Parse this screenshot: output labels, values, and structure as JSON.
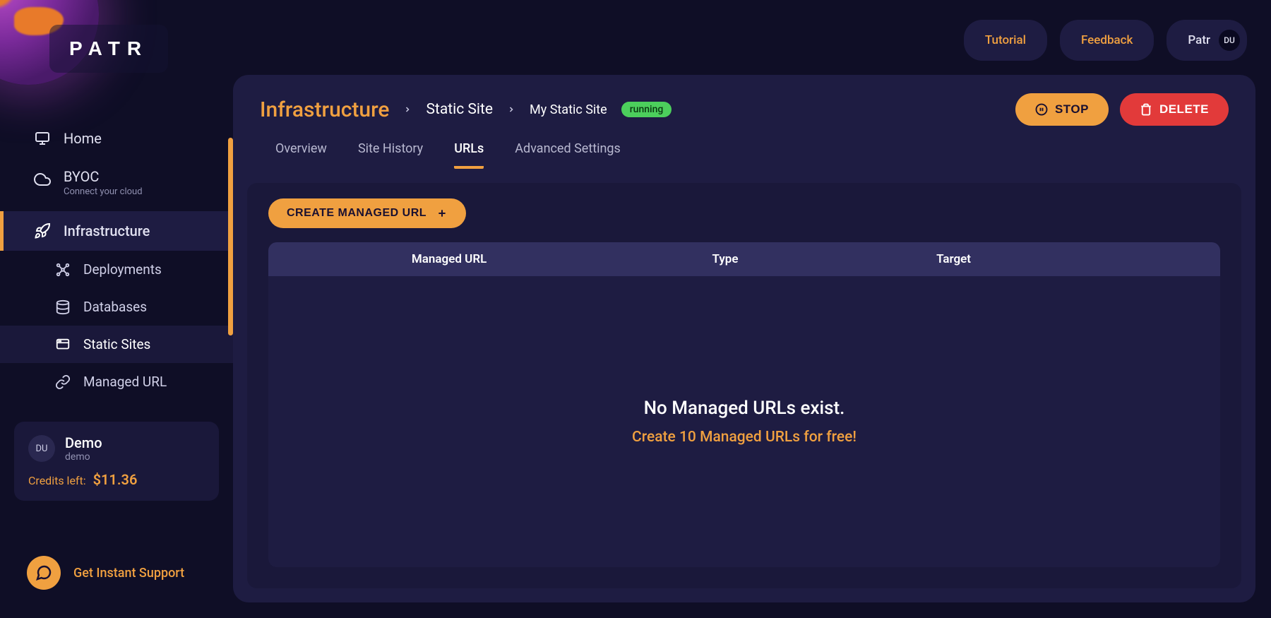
{
  "brand": "PATR",
  "topbar": {
    "tutorial": "Tutorial",
    "feedback": "Feedback",
    "workspace": "Patr",
    "avatar": "DU"
  },
  "sidebar": {
    "home": "Home",
    "byoc": {
      "label": "BYOC",
      "sub": "Connect your cloud"
    },
    "infrastructure": "Infrastructure",
    "deployments": "Deployments",
    "databases": "Databases",
    "static_sites": "Static Sites",
    "managed_url": "Managed URL"
  },
  "workspace_card": {
    "avatar": "DU",
    "name": "Demo",
    "sub": "demo",
    "credits_label": "Credits left:",
    "credits_amount": "$11.36"
  },
  "support": "Get Instant Support",
  "breadcrumb": {
    "root": "Infrastructure",
    "level1": "Static Site",
    "level2": "My Static Site",
    "status": "running"
  },
  "actions": {
    "stop": "STOP",
    "delete": "DELETE"
  },
  "tabs": {
    "overview": "Overview",
    "history": "Site History",
    "urls": "URLs",
    "advanced": "Advanced Settings"
  },
  "create_button": "CREATE MANAGED URL",
  "table": {
    "columns": {
      "managed_url": "Managed URL",
      "type": "Type",
      "target": "Target"
    },
    "empty_line1": "No Managed URLs exist.",
    "empty_line2": "Create 10 Managed URLs for free!"
  }
}
